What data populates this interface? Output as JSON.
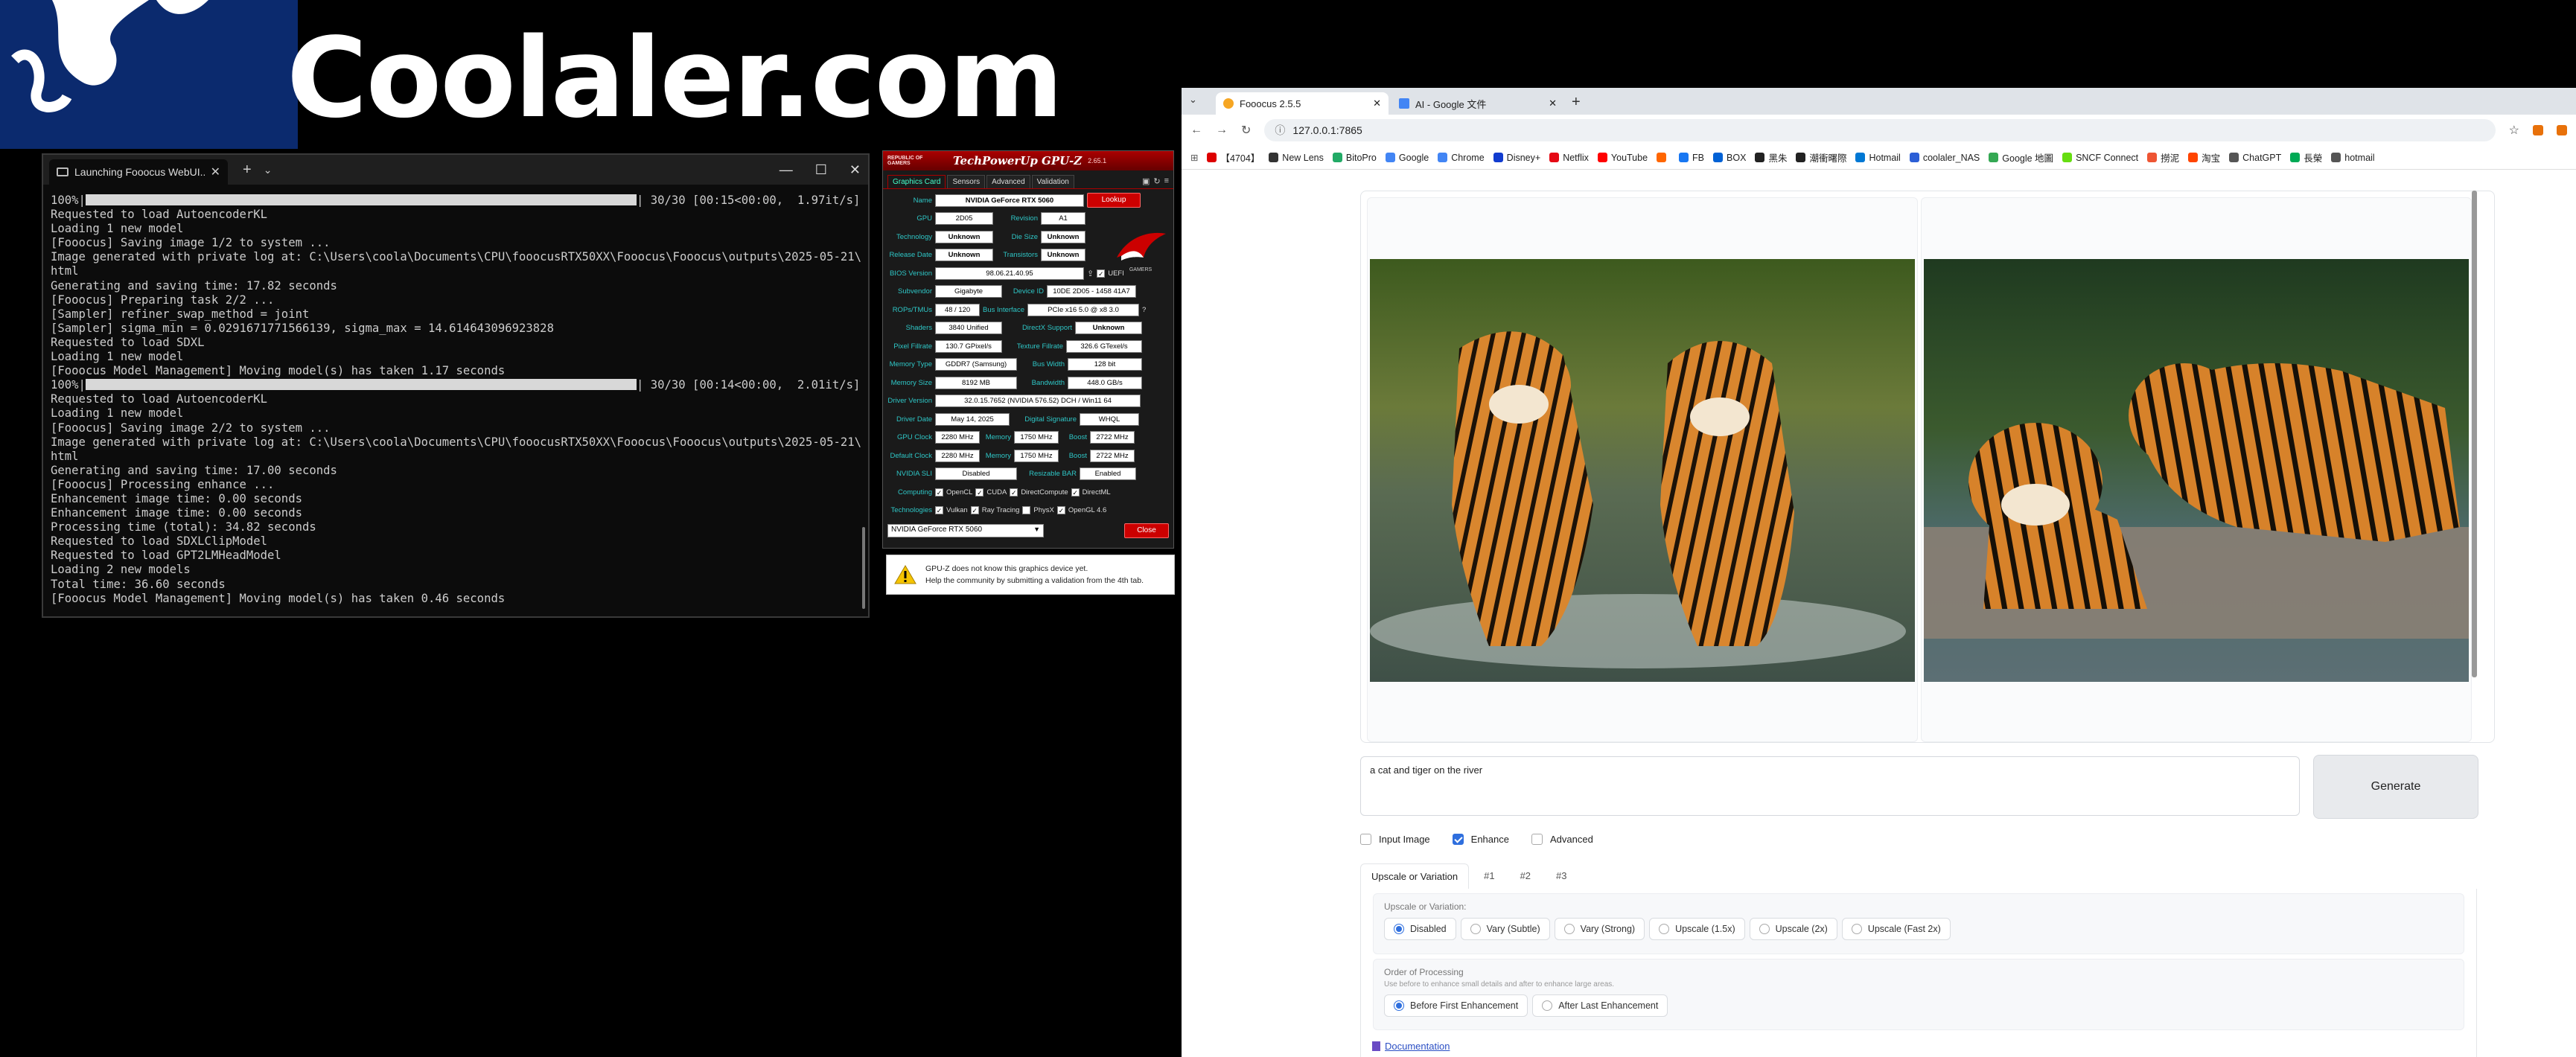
{
  "banner": {
    "text": "Coolaler.com"
  },
  "terminal": {
    "tab_title": "Launching Fooocus WebUI...",
    "lines": [
      {
        "pre": "100%|",
        "bar": true,
        "post": "| 30/30 [00:15<00:00,  1.97it/s]"
      },
      {
        "text": "Requested to load AutoencoderKL"
      },
      {
        "text": "Loading 1 new model"
      },
      {
        "text": "[Fooocus] Saving image 1/2 to system ..."
      },
      {
        "text": "Image generated with private log at: C:\\Users\\coola\\Documents\\CPU\\fooocusRTX50XX\\Fooocus\\Fooocus\\outputs\\2025-05-21\\log."
      },
      {
        "text": "html"
      },
      {
        "text": "Generating and saving time: 17.82 seconds"
      },
      {
        "text": "[Fooocus] Preparing task 2/2 ..."
      },
      {
        "text": "[Sampler] refiner_swap_method = joint"
      },
      {
        "text": "[Sampler] sigma_min = 0.0291671771566139, sigma_max = 14.614643096923828"
      },
      {
        "text": "Requested to load SDXL"
      },
      {
        "text": "Loading 1 new model"
      },
      {
        "text": "[Fooocus Model Management] Moving model(s) has taken 1.17 seconds"
      },
      {
        "pre": "100%|",
        "bar": true,
        "post": "| 30/30 [00:14<00:00,  2.01it/s]"
      },
      {
        "text": "Requested to load AutoencoderKL"
      },
      {
        "text": "Loading 1 new model"
      },
      {
        "text": "[Fooocus] Saving image 2/2 to system ..."
      },
      {
        "text": "Image generated with private log at: C:\\Users\\coola\\Documents\\CPU\\fooocusRTX50XX\\Fooocus\\Fooocus\\outputs\\2025-05-21\\log."
      },
      {
        "text": "html"
      },
      {
        "text": "Generating and saving time: 17.00 seconds"
      },
      {
        "text": "[Fooocus] Processing enhance ..."
      },
      {
        "text": "Enhancement image time: 0.00 seconds"
      },
      {
        "text": "Enhancement image time: 0.00 seconds"
      },
      {
        "text": "Processing time (total): 34.82 seconds"
      },
      {
        "text": "Requested to load SDXLClipModel"
      },
      {
        "text": "Requested to load GPT2LMHeadModel"
      },
      {
        "text": "Loading 2 new models"
      },
      {
        "text": "Total time: 36.60 seconds"
      },
      {
        "text": "[Fooocus Model Management] Moving model(s) has taken 0.46 seconds"
      }
    ]
  },
  "gpuz": {
    "logo": "REPUBLIC OF GAMERS",
    "title": "TechPowerUp GPU-Z",
    "version": "2.65.1",
    "tabs": [
      "Graphics Card",
      "Sensors",
      "Advanced",
      "Validation"
    ],
    "name": "NVIDIA GeForce RTX 5060",
    "lookup": "Lookup",
    "gpu": "2D05",
    "revision": "A1",
    "technology": "Unknown",
    "die_size": "Unknown",
    "release_date": "Unknown",
    "transistors": "Unknown",
    "bios_version": "98.06.21.40.95",
    "uefi": "UEFI",
    "subvendor": "Gigabyte",
    "device_id": "10DE 2D05 - 1458 41A7",
    "rops_tmus": "48 / 120",
    "bus_interface": "PCIe x16 5.0 @ x8 3.0",
    "shaders": "3840 Unified",
    "directx_support": "Unknown",
    "pixel_fillrate": "130.7 GPixel/s",
    "texture_fillrate": "326.6 GTexel/s",
    "memory_type": "GDDR7 (Samsung)",
    "bus_width": "128 bit",
    "memory_size": "8192 MB",
    "bandwidth": "448.0 GB/s",
    "driver_version": "32.0.15.7652 (NVIDIA 576.52) DCH / Win11 64",
    "driver_date": "May 14, 2025",
    "digital_signature": "WHQL",
    "gpu_clock": "2280 MHz",
    "memory_clock": "1750 MHz",
    "boost_clock": "2722 MHz",
    "default_clock": "2280 MHz",
    "default_memory": "1750 MHz",
    "default_boost": "2722 MHz",
    "nvidia_sli": "Disabled",
    "resizable_bar": "Enabled",
    "labels": {
      "name": "Name",
      "gpu": "GPU",
      "revision": "Revision",
      "technology": "Technology",
      "die_size": "Die Size",
      "release_date": "Release Date",
      "transistors": "Transistors",
      "bios": "BIOS Version",
      "subvendor": "Subvendor",
      "device_id": "Device ID",
      "rops": "ROPs/TMUs",
      "bus": "Bus Interface",
      "shaders": "Shaders",
      "dx": "DirectX Support",
      "pixel": "Pixel Fillrate",
      "texture": "Texture Fillrate",
      "memtype": "Memory Type",
      "buswidth": "Bus Width",
      "memsize": "Memory Size",
      "bandwidth": "Bandwidth",
      "driverver": "Driver Version",
      "driverdate": "Driver Date",
      "digsig": "Digital Signature",
      "gpuclock": "GPU Clock",
      "memory": "Memory",
      "boost": "Boost",
      "defclock": "Default Clock",
      "sli": "NVIDIA SLI",
      "rebar": "Resizable BAR",
      "computing": "Computing",
      "technologies": "Technologies"
    },
    "computing": [
      "OpenCL",
      "CUDA",
      "DirectCompute",
      "DirectML"
    ],
    "technologies": [
      "Vulkan",
      "Ray Tracing",
      "PhysX",
      "OpenGL 4.6"
    ],
    "selected_gpu": "NVIDIA GeForce RTX 5060",
    "close": "Close",
    "note_line1": "GPU-Z does not know this graphics device yet.",
    "note_line2": "Help the community by submitting a validation from the 4th tab."
  },
  "browser": {
    "tabs": [
      {
        "title": "Fooocus 2.5.5"
      },
      {
        "title": "AI - Google 文件"
      }
    ],
    "url": "127.0.0.1:7865",
    "bookmarks": [
      "【4704】",
      "New Lens",
      "BitoPro",
      "Google",
      "Chrome",
      "Disney+",
      "Netflix",
      "YouTube",
      "",
      "FB",
      "BOX",
      "黑朱",
      "潮衝曙際",
      "Hotmail",
      "coolaler_NAS",
      "Google 地圖",
      "SNCF Connect",
      "撈泥",
      "淘宝",
      "ChatGPT",
      "長榮",
      "hotmail"
    ],
    "bookmark_colors": [
      "#d00",
      "#333",
      "#2a6",
      "#4285f4",
      "#4285f4",
      "#113ccf",
      "#e50914",
      "#f00",
      "#f60",
      "#1877f2",
      "#0061d5",
      "#222",
      "#222",
      "#0078d4",
      "#2c5fd6",
      "#34a853",
      "#6d1",
      "#e53",
      "#f40",
      "#555",
      "#0a5",
      "#555"
    ]
  },
  "fooocus": {
    "prompt": "a cat and tiger on the river",
    "generate": "Generate",
    "checks": [
      {
        "label": "Input Image",
        "checked": false
      },
      {
        "label": "Enhance",
        "checked": true
      },
      {
        "label": "Advanced",
        "checked": false
      }
    ],
    "tabs": [
      "Upscale or Variation",
      "#1",
      "#2",
      "#3"
    ],
    "upscale_label": "Upscale or Variation:",
    "upscale_options": [
      "Disabled",
      "Vary (Subtle)",
      "Vary (Strong)",
      "Upscale (1.5x)",
      "Upscale (2x)",
      "Upscale (Fast 2x)"
    ],
    "upscale_selected": "Disabled",
    "order_label": "Order of Processing",
    "order_hint": "Use before to enhance small details and after to enhance large areas.",
    "order_options": [
      "Before First Enhancement",
      "After Last Enhancement"
    ],
    "order_selected": "Before First Enhancement",
    "documentation": "Documentation"
  },
  "colors": {
    "accent": "#2f6fde",
    "gpuz_label": "#2ec6c6",
    "gpuz_red": "#cc0000"
  }
}
